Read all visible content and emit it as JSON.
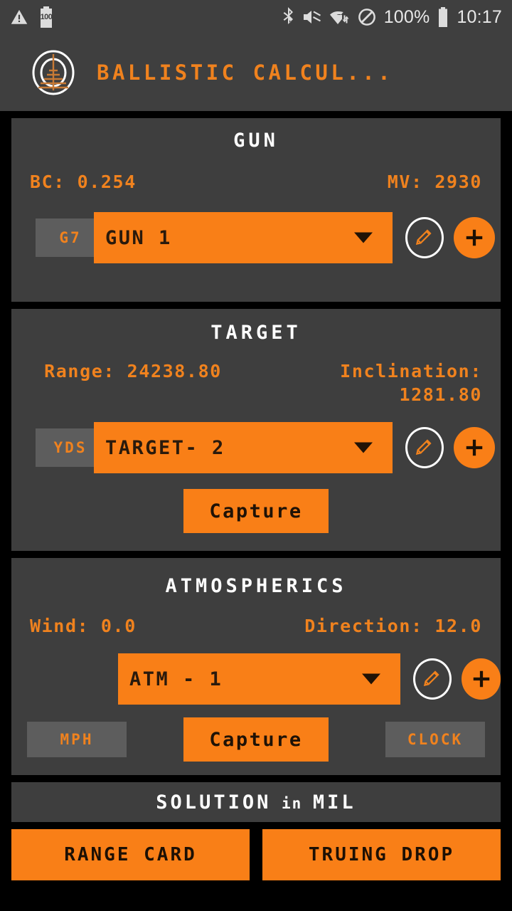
{
  "status_bar": {
    "left_icons": [
      "warning-triangle-icon",
      "battery-saver-icon"
    ],
    "battery_saver_value": "100",
    "right_icons": [
      "bluetooth-icon",
      "volume-muted-icon",
      "wifi-icon",
      "do-not-disturb-icon"
    ],
    "battery_percent": "100%",
    "clock": "10:17"
  },
  "app_bar": {
    "logo": "scope-reticle-icon",
    "title": "BALLISTIC CALCUL..."
  },
  "colors": {
    "accent_orange": "#f97f17",
    "text_orange": "#f0821e",
    "card_bg": "#3e3e3e",
    "page_bg": "#000000",
    "badge_gray": "#5d5d5d"
  },
  "gun": {
    "title": "GUN",
    "bc_label": "BC: 0.254",
    "mv_label": "MV: 2930",
    "unit_badge": "G7",
    "selected": "GUN 1",
    "edit_icon": "pencil-icon",
    "add_icon": "plus-icon"
  },
  "target": {
    "title": "TARGET",
    "range_label": "Range: 24238.80",
    "inclination_label": "Inclination: 1281.80",
    "unit_badge": "YDS",
    "selected": "TARGET- 2",
    "capture_label": "Capture",
    "edit_icon": "pencil-icon",
    "add_icon": "plus-icon"
  },
  "atmospherics": {
    "title": "ATMOSPHERICS",
    "wind_label": "Wind: 0.0",
    "direction_label": "Direction: 12.0",
    "selected": "ATM - 1",
    "speed_unit": "MPH",
    "capture_label": "Capture",
    "direction_unit": "CLOCK",
    "edit_icon": "pencil-icon",
    "add_icon": "plus-icon"
  },
  "solution": {
    "title_main": "SOLUTION",
    "title_lower": " in ",
    "title_unit": "MIL",
    "range_card_label": "RANGE CARD",
    "truing_drop_label": "TRUING DROP"
  }
}
